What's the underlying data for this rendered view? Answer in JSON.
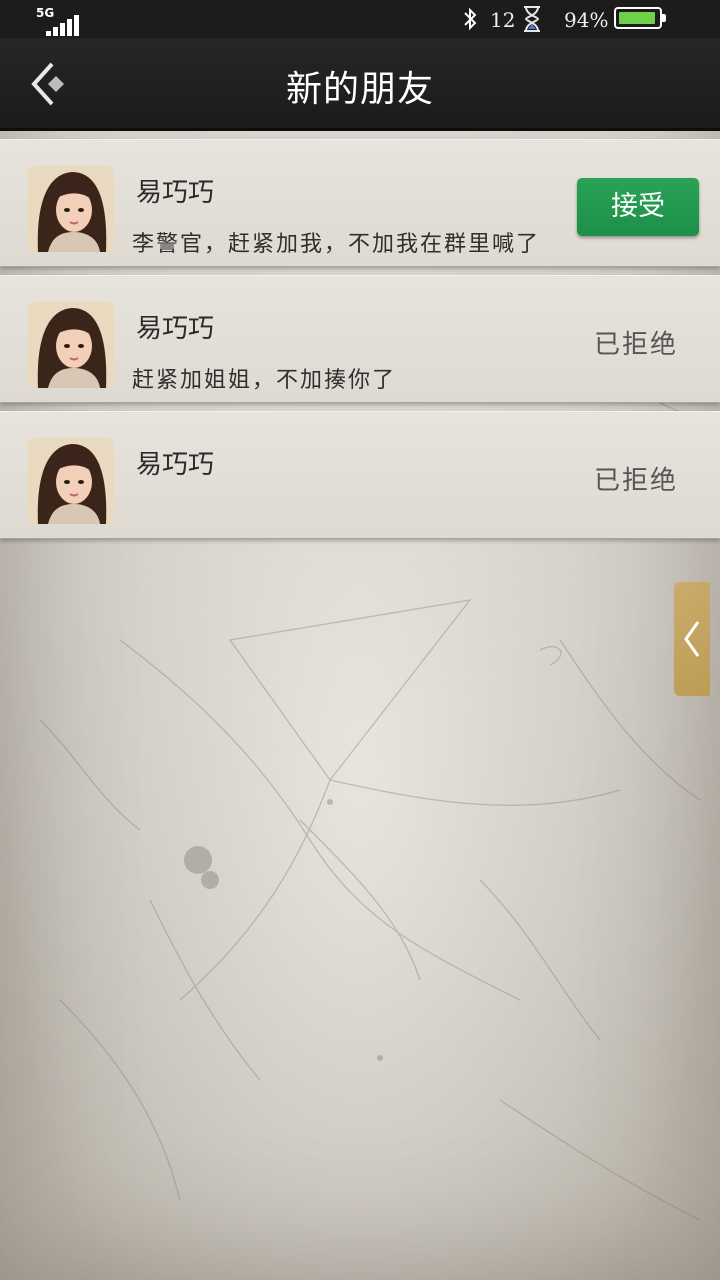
{
  "status_bar": {
    "network": "5G",
    "notification_count": "12",
    "battery_percent": "94%",
    "battery_level": 0.94,
    "battery_color": "#6fd04a"
  },
  "header": {
    "title": "新的朋友",
    "back_icon": "back-chevron-icon"
  },
  "requests": [
    {
      "name": "易巧巧",
      "message": "李警官，赶紧加我，不加我在群里喊了",
      "action": "接受",
      "state": "pending"
    },
    {
      "name": "易巧巧",
      "message": "赶紧加姐姐，不加揍你了",
      "status": "已拒绝",
      "state": "rejected"
    },
    {
      "name": "易巧巧",
      "message": "",
      "status": "已拒绝",
      "state": "rejected"
    }
  ],
  "colors": {
    "accept_button": "#1e8f49",
    "title_bar": "#1f1f1f",
    "drawer_handle": "#c9a14e"
  }
}
